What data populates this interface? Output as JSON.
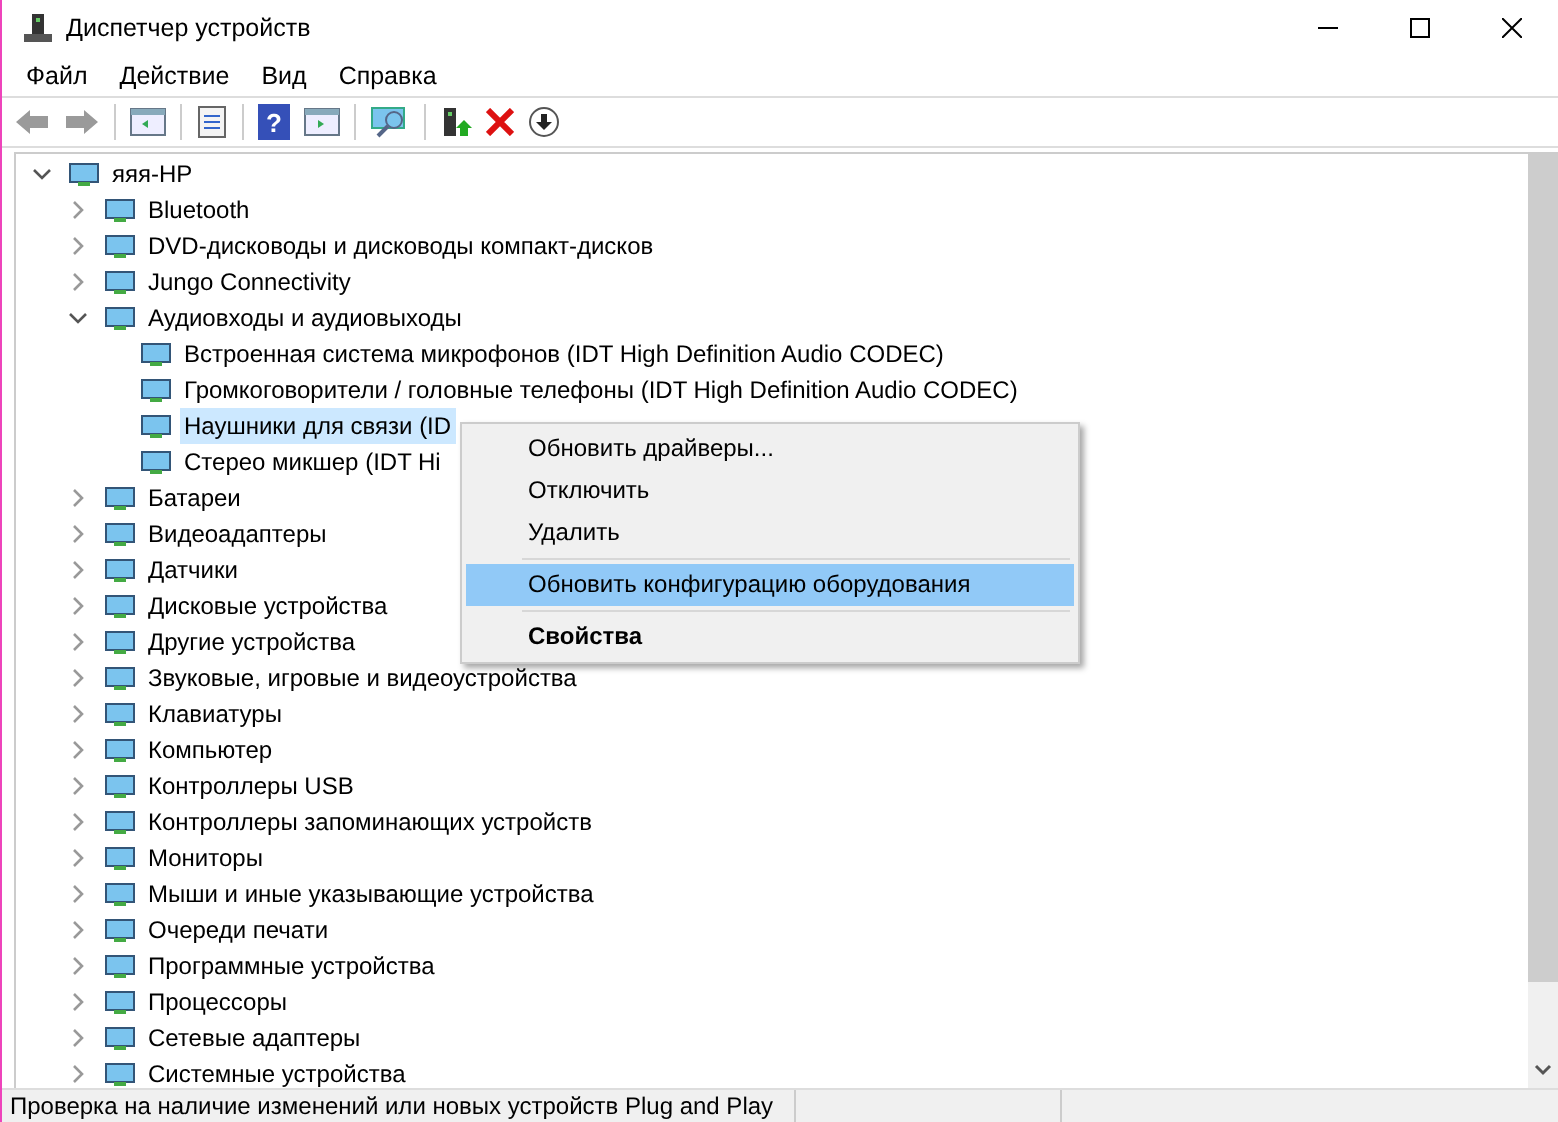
{
  "window": {
    "title": "Диспетчер устройств"
  },
  "menu_bar": [
    "Файл",
    "Действие",
    "Вид",
    "Справка"
  ],
  "toolbar": {
    "help_label": "?"
  },
  "tree": {
    "label": "яяя-HP",
    "expanded": true,
    "children": [
      {
        "label": "Bluetooth",
        "expanded": false
      },
      {
        "label": "DVD-дисководы и дисководы компакт-дисков",
        "expanded": false
      },
      {
        "label": "Jungo Connectivity",
        "expanded": false
      },
      {
        "label": "Аудиовходы и аудиовыходы",
        "expanded": true,
        "children": [
          {
            "label": "Встроенная система микрофонов (IDT High Definition Audio CODEC)",
            "selected": false
          },
          {
            "label": "Громкоговорители / головные телефоны (IDT High Definition Audio CODEC)",
            "selected": false
          },
          {
            "label": "Наушники для связи (ID",
            "selected": true
          },
          {
            "label": "Стерео микшер (IDT Hi",
            "selected": false
          }
        ]
      },
      {
        "label": "Батареи",
        "expanded": false
      },
      {
        "label": "Видеоадаптеры",
        "expanded": false
      },
      {
        "label": "Датчики",
        "expanded": false
      },
      {
        "label": "Дисковые устройства",
        "expanded": false
      },
      {
        "label": "Другие устройства",
        "expanded": false
      },
      {
        "label": "Звуковые, игровые и видеоустройства",
        "expanded": false
      },
      {
        "label": "Клавиатуры",
        "expanded": false
      },
      {
        "label": "Компьютер",
        "expanded": false
      },
      {
        "label": "Контроллеры USB",
        "expanded": false
      },
      {
        "label": "Контроллеры запоминающих устройств",
        "expanded": false
      },
      {
        "label": "Мониторы",
        "expanded": false
      },
      {
        "label": "Мыши и иные указывающие устройства",
        "expanded": false
      },
      {
        "label": "Очереди печати",
        "expanded": false
      },
      {
        "label": "Программные устройства",
        "expanded": false
      },
      {
        "label": "Процессоры",
        "expanded": false
      },
      {
        "label": "Сетевые адаптеры",
        "expanded": false
      },
      {
        "label": "Системные устройства",
        "expanded": false
      }
    ]
  },
  "context_menu": [
    {
      "kind": "command",
      "label": "Обновить драйверы...",
      "selected": false,
      "default": false
    },
    {
      "kind": "command",
      "label": "Отключить",
      "selected": false,
      "default": false
    },
    {
      "kind": "command",
      "label": "Удалить",
      "selected": false,
      "default": false
    },
    {
      "kind": "separator"
    },
    {
      "kind": "command",
      "label": "Обновить конфигурацию оборудования",
      "selected": true,
      "default": false
    },
    {
      "kind": "separator"
    },
    {
      "kind": "command",
      "label": "Свойства",
      "selected": false,
      "default": true
    }
  ],
  "status_bar": "Проверка на наличие изменений или новых устройств Plug and Play"
}
